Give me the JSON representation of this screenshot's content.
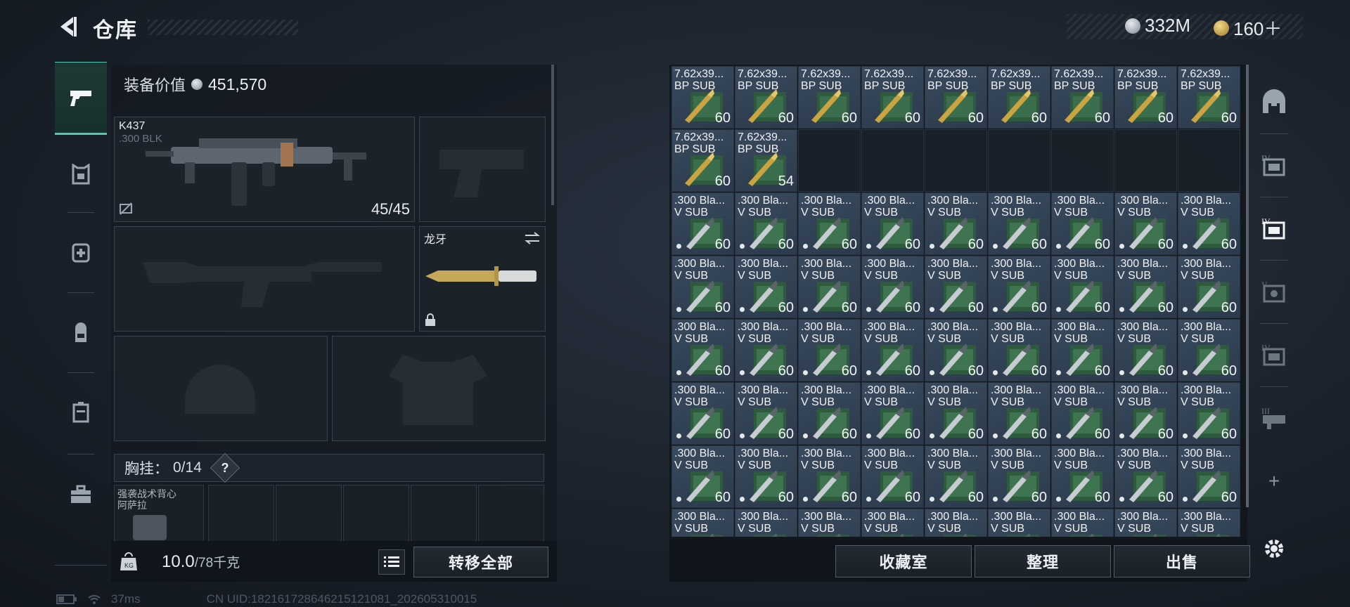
{
  "header": {
    "title": "仓库"
  },
  "currency": [
    {
      "icon": "silver-coin-icon",
      "value": "332M"
    },
    {
      "icon": "gold-coin-icon",
      "value": "160＋"
    }
  ],
  "left_nav": {
    "items": [
      {
        "name": "weapons",
        "icon": "pistol-icon",
        "active": true
      },
      {
        "name": "armor",
        "icon": "vest-icon",
        "active": false
      },
      {
        "name": "medical",
        "icon": "medical-bag-icon",
        "active": false
      },
      {
        "name": "backpack",
        "icon": "backpack-icon",
        "active": false
      },
      {
        "name": "container",
        "icon": "case-icon",
        "active": false
      },
      {
        "name": "toolbox",
        "icon": "toolbox-icon",
        "active": false
      }
    ]
  },
  "equipment": {
    "value_label": "装备价值",
    "value": "451,570",
    "primary_weapon": {
      "name": "K437",
      "caliber": ".300 BLK",
      "ammo": "45/45"
    },
    "melee": {
      "name": "龙牙"
    },
    "vest_header": {
      "label": "胸挂：",
      "count": "0/14",
      "help": "?"
    },
    "vest_item": {
      "line1": "强袭战术背心",
      "line2": "阿萨拉"
    },
    "weight": {
      "value": "10.0",
      "max": "/78千克"
    },
    "transfer_all": "转移全部"
  },
  "warehouse": {
    "ammo_a": {
      "line1": "7.62x39...",
      "line2": "BP SUB"
    },
    "ammo_b": {
      "line1": ".300 Bla...",
      "line2": "V SUB"
    },
    "row1_counts": [
      "60",
      "60",
      "60",
      "60",
      "60",
      "60",
      "60",
      "60",
      "60"
    ],
    "row2_counts": [
      "60",
      "54"
    ],
    "block_count": "60",
    "block_rows": 6,
    "partial_row": true
  },
  "footer_buttons": {
    "collection": "收藏室",
    "sort": "整理",
    "sell": "出售"
  },
  "right_nav": {
    "items": [
      {
        "icon": "safe-house-icon",
        "label": ""
      },
      {
        "icon": "storage-icon",
        "label": "IV"
      },
      {
        "icon": "storage-icon",
        "label": "IV"
      },
      {
        "icon": "storage-icon",
        "label": "V"
      },
      {
        "icon": "storage-icon",
        "label": "IV"
      },
      {
        "icon": "storage-icon",
        "label": "III"
      },
      {
        "icon": "plus-icon",
        "label": "+"
      }
    ],
    "settings_icon": "gear-icon"
  },
  "status": {
    "ping": "37ms",
    "uid": "CN UID:18216172864621512108​1_202605310015"
  }
}
